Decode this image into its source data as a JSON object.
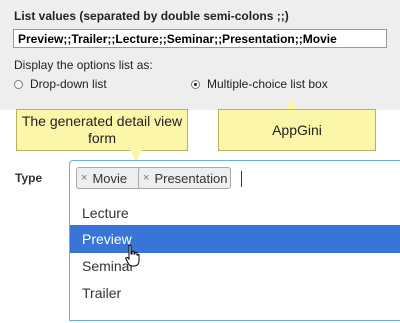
{
  "settings": {
    "list_label": "List values (separated by double semi-colons ;;)",
    "list_value": "Preview;;Trailer;;Lecture;;Seminar;;Presentation;;Movie",
    "display_label": "Display the options list as:",
    "radio_dropdown_label": "Drop-down list",
    "radio_multi_label": "Multiple-choice list box",
    "selected_option": "Multiple-choice list box"
  },
  "callouts": {
    "detail_view": "The generated detail view form",
    "appgini": "AppGini"
  },
  "form": {
    "field_label": "Type",
    "selected_tags": [
      "Movie",
      "Presentation"
    ],
    "tag_remove_symbol": "×",
    "options": [
      "Lecture",
      "Preview",
      "Seminar",
      "Trailer"
    ],
    "highlighted_option": "Preview"
  },
  "colors": {
    "panel_bg": "#eeeeee",
    "callout_bg": "#fbf6a8",
    "highlight_bg": "#3875d7",
    "focus_border": "#66afe9"
  }
}
